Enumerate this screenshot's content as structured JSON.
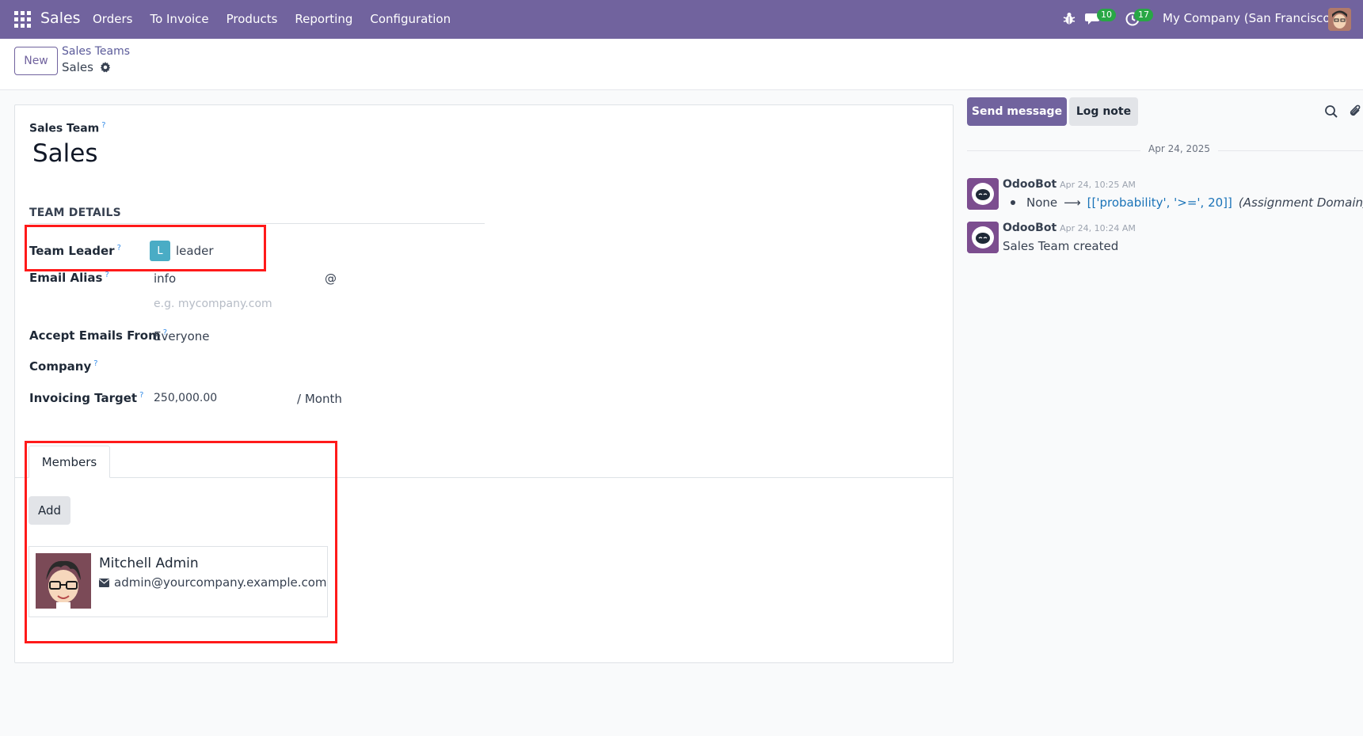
{
  "navbar": {
    "app_name": "Sales",
    "menu": [
      "Orders",
      "To Invoice",
      "Products",
      "Reporting",
      "Configuration"
    ],
    "messages_count": "10",
    "activities_count": "17",
    "company": "My Company (San Francisco)"
  },
  "control_panel": {
    "new_label": "New",
    "breadcrumb_parent": "Sales Teams",
    "breadcrumb_current": "Sales"
  },
  "form": {
    "sales_team_label": "Sales Team",
    "sales_team_value": "Sales",
    "section_title": "TEAM DETAILS",
    "team_leader_label": "Team Leader",
    "team_leader_initial": "L",
    "team_leader_value": "leader",
    "email_alias_label": "Email Alias",
    "email_alias_value": "info",
    "email_alias_at": "@",
    "email_domain_placeholder": "e.g. mycompany.com",
    "accept_emails_label": "Accept Emails From",
    "accept_emails_value": "Everyone",
    "company_label": "Company",
    "invoicing_target_label": "Invoicing Target",
    "invoicing_target_value": "250,000.00",
    "invoicing_target_unit": "/ Month",
    "help_mark": "?"
  },
  "tabs": {
    "members_label": "Members",
    "add_label": "Add"
  },
  "members": [
    {
      "name": "Mitchell Admin",
      "email": "admin@yourcompany.example.com"
    }
  ],
  "chatter": {
    "send_message_label": "Send message",
    "log_note_label": "Log note",
    "date_separator": "Apr 24, 2025",
    "messages": [
      {
        "author": "OdooBot",
        "time": "Apr 24, 10:25 AM",
        "old_value": "None",
        "new_value": "[['probability', '>=', 20]]",
        "field": "(Assignment Domain)"
      },
      {
        "author": "OdooBot",
        "time": "Apr 24, 10:24 AM",
        "body": "Sales Team created"
      }
    ]
  },
  "colors": {
    "brand": "#71639e",
    "badge": "#28a745",
    "highlight": "#ff1a1a",
    "link": "#1a73b8",
    "avatar_leader": "#4aacc5"
  }
}
